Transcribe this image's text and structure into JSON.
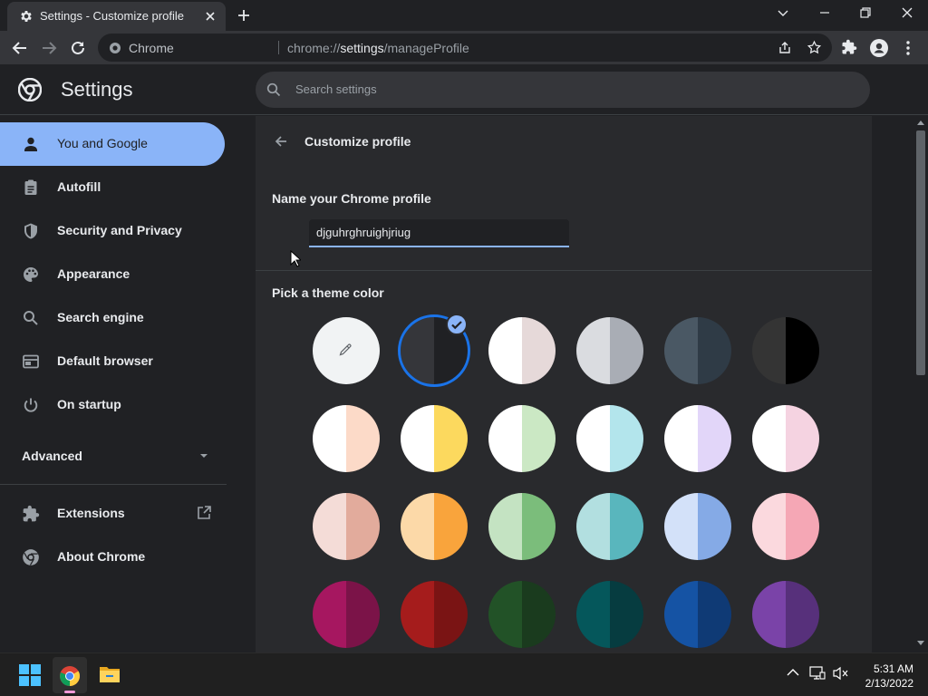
{
  "window": {
    "tab_title": "Settings - Customize profile",
    "address_chip": "Chrome",
    "url_scheme": "chrome://",
    "url_host": "settings",
    "url_path": "/manageProfile"
  },
  "header": {
    "title": "Settings",
    "search_placeholder": "Search settings"
  },
  "sidebar": {
    "items": [
      {
        "label": "You and Google",
        "icon": "person-icon",
        "active": true
      },
      {
        "label": "Autofill",
        "icon": "clipboard-icon"
      },
      {
        "label": "Security and Privacy",
        "icon": "shield-icon"
      },
      {
        "label": "Appearance",
        "icon": "palette-icon"
      },
      {
        "label": "Search engine",
        "icon": "search-icon"
      },
      {
        "label": "Default browser",
        "icon": "browser-icon"
      },
      {
        "label": "On startup",
        "icon": "power-icon"
      }
    ],
    "advanced_label": "Advanced",
    "extensions_label": "Extensions",
    "about_label": "About Chrome"
  },
  "main": {
    "subpage_title": "Customize profile",
    "name_section_label": "Name your Chrome profile",
    "profile_name_value": "djguhrghruighjriug",
    "theme_section_label": "Pick a theme color",
    "selected_swatch_index": 1,
    "swatches": [
      {
        "name": "custom-color",
        "left": "#f1f3f4",
        "right": "#f1f3f4"
      },
      {
        "name": "default-dark",
        "left": "#35363a",
        "right": "#202124"
      },
      {
        "name": "warm-grey",
        "left": "#ffffff",
        "right": "#e6d9d9"
      },
      {
        "name": "grey",
        "left": "#dadce0",
        "right": "#a9adb5"
      },
      {
        "name": "slate",
        "left": "#4a5864",
        "right": "#2f3b46"
      },
      {
        "name": "black",
        "left": "#343434",
        "right": "#000000"
      },
      {
        "name": "peach",
        "left": "#ffffff",
        "right": "#fcdac8"
      },
      {
        "name": "yellow",
        "left": "#ffffff",
        "right": "#fcd95e"
      },
      {
        "name": "green-light",
        "left": "#ffffff",
        "right": "#cbe8c4"
      },
      {
        "name": "cyan-light",
        "left": "#ffffff",
        "right": "#b3e5ec"
      },
      {
        "name": "lavender",
        "left": "#ffffff",
        "right": "#e2d6f9"
      },
      {
        "name": "pink-light",
        "left": "#ffffff",
        "right": "#f5d3e1"
      },
      {
        "name": "rose",
        "left": "#f4dcd7",
        "right": "#e2ab9c"
      },
      {
        "name": "orange",
        "left": "#fcd9a8",
        "right": "#f9a43c"
      },
      {
        "name": "green",
        "left": "#c4e3c2",
        "right": "#7bbd7b"
      },
      {
        "name": "teal",
        "left": "#b2dfe0",
        "right": "#59b6bd"
      },
      {
        "name": "blue",
        "left": "#d3e1f9",
        "right": "#85aae6"
      },
      {
        "name": "pink",
        "left": "#fbd9de",
        "right": "#f5a7b5"
      },
      {
        "name": "magenta",
        "left": "#a61760",
        "right": "#7b1348"
      },
      {
        "name": "red",
        "left": "#a51c1c",
        "right": "#7a1414"
      },
      {
        "name": "forest",
        "left": "#225227",
        "right": "#1a3b1e"
      },
      {
        "name": "dark-teal",
        "left": "#05575b",
        "right": "#063c40"
      },
      {
        "name": "navy",
        "left": "#1553a4",
        "right": "#0f3a75"
      },
      {
        "name": "purple",
        "left": "#7a43a8",
        "right": "#57307b"
      }
    ]
  },
  "taskbar": {
    "time": "5:31 AM",
    "date": "2/13/2022"
  },
  "colors": {
    "accent": "#8ab4f8",
    "focus_ring": "#1a73e8",
    "page_bg": "#202124",
    "card_bg": "#292a2d"
  }
}
